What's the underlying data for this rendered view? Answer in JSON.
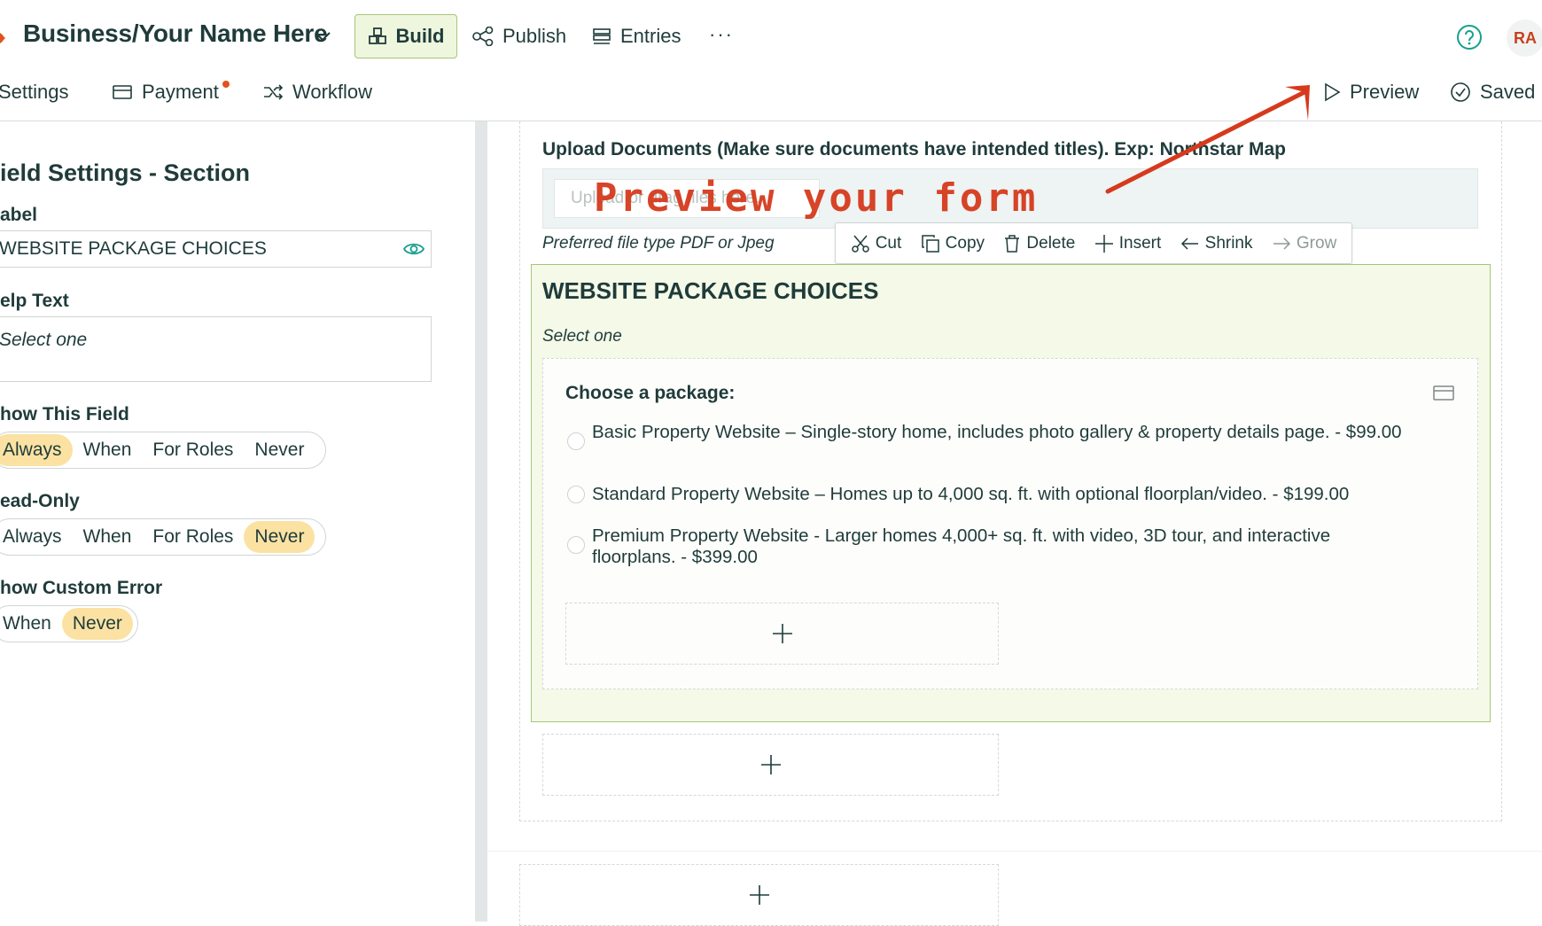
{
  "header": {
    "brand": "Business/Your Name Here",
    "tabs": [
      {
        "label": "Build",
        "icon": "blocks-icon"
      },
      {
        "label": "Publish",
        "icon": "share-icon"
      },
      {
        "label": "Entries",
        "icon": "list-icon"
      }
    ],
    "more": "···",
    "avatar": "RA",
    "subtabs": [
      {
        "label": "Settings"
      },
      {
        "label": "Payment",
        "icon": "card-icon"
      },
      {
        "label": "Workflow",
        "icon": "shuffle-icon"
      }
    ],
    "preview": "Preview",
    "saved": "Saved"
  },
  "left_panel": {
    "title": "ield Settings - Section",
    "label_heading": "abel",
    "label_value": "WEBSITE PACKAGE CHOICES",
    "help_heading": "elp Text",
    "help_value": "Select one",
    "show_field": {
      "heading": "how This Field",
      "options": [
        "Always",
        "When",
        "For Roles",
        "Never"
      ],
      "selected": "Always"
    },
    "read_only": {
      "heading": "ead-Only",
      "options": [
        "Always",
        "When",
        "For Roles",
        "Never"
      ],
      "selected": "Never"
    },
    "custom_error": {
      "heading": "how Custom Error",
      "options": [
        "When",
        "Never"
      ],
      "selected": "Never"
    }
  },
  "form": {
    "upload_label": "Upload Documents (Make sure documents have intended titles).  Exp:  Northstar Map",
    "upload_placeholder": "Upload or drag files here.",
    "upload_help": "Preferred file type PDF or Jpeg",
    "toolbar": {
      "cut": "Cut",
      "copy": "Copy",
      "delete": "Delete",
      "insert": "Insert",
      "shrink": "Shrink",
      "grow": "Grow"
    },
    "section_title": "WEBSITE PACKAGE CHOICES",
    "section_help": "Select one",
    "field_label": "Choose a package:",
    "options": [
      "Basic Property Website – Single-story home, includes photo gallery & property details page. - $99.00",
      "Standard Property Website – Homes up to 4,000 sq. ft. with optional floorplan/video. - $199.00",
      "Premium Property Website - Larger homes 4,000+ sq. ft. with video, 3D tour, and interactive floorplans. - $399.00"
    ]
  },
  "annotation": {
    "text": "Preview your form",
    "color": "#d63a1c"
  },
  "colors": {
    "accent": "#c8401e",
    "brand_text": "#1f3b3a",
    "section_bg": "#f4f9e8",
    "section_border": "#a6c67a",
    "selected_pill": "#fbe2a3"
  }
}
